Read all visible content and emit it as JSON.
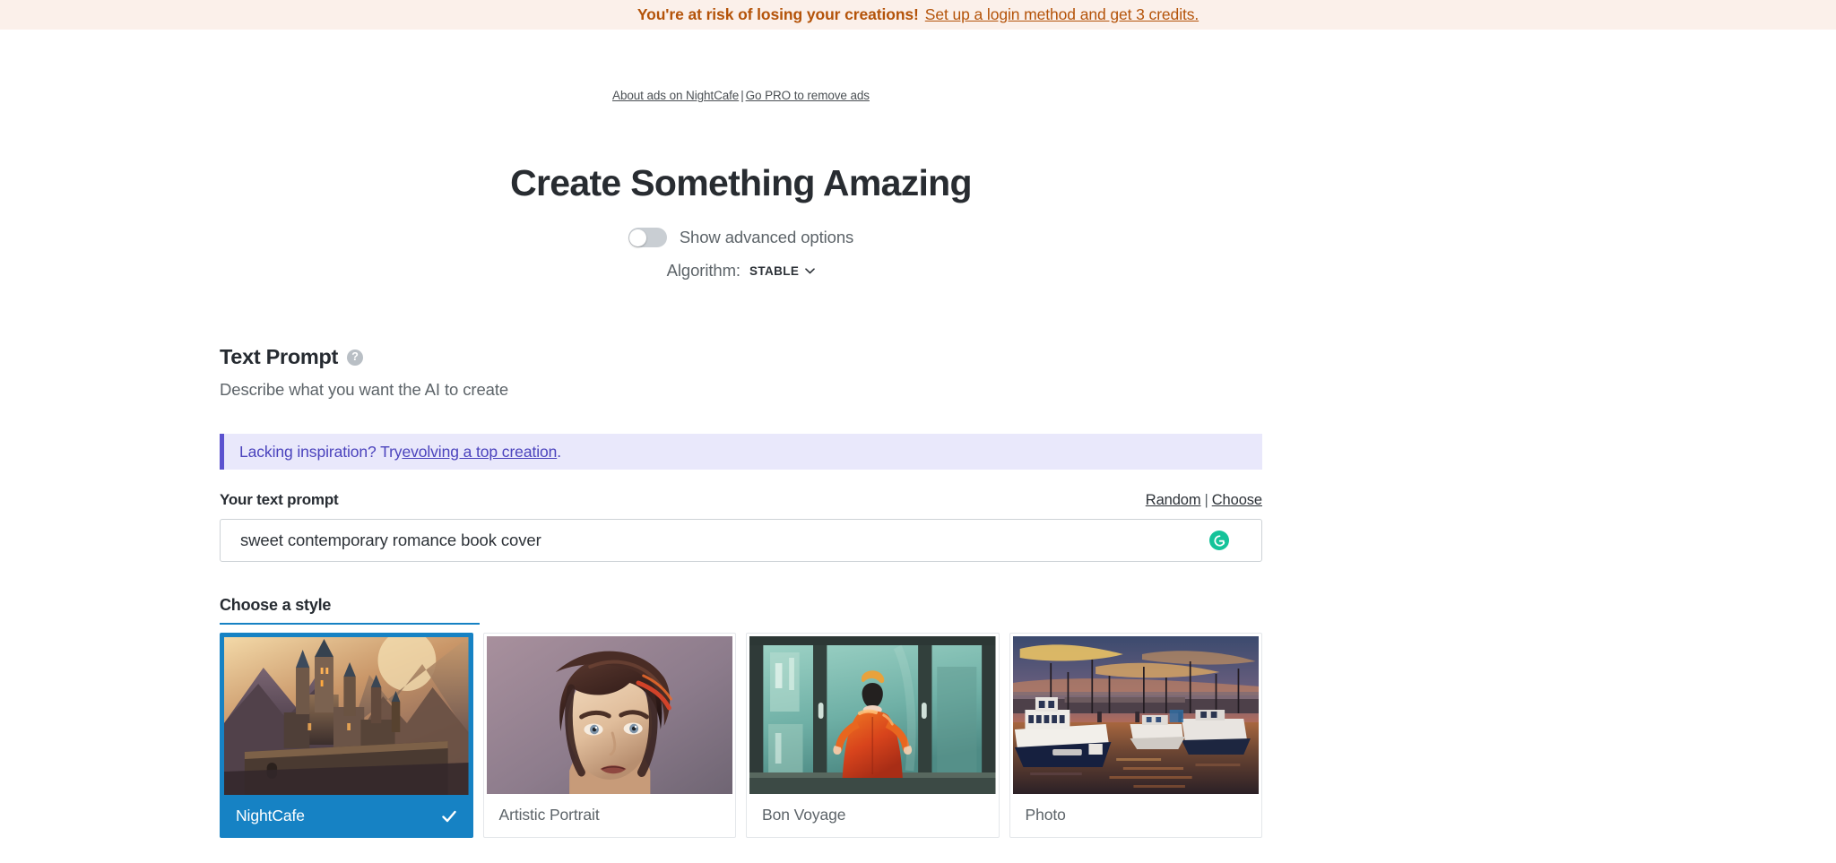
{
  "banner": {
    "warning": "You're at risk of losing your creations!",
    "link": "Set up a login method and get 3 credits."
  },
  "ads": {
    "about": "About ads on NightCafe",
    "separator": "|",
    "pro": "Go PRO to remove ads"
  },
  "hero": {
    "title": "Create Something Amazing",
    "advanced_toggle_label": "Show advanced options",
    "advanced_toggle_state": "off",
    "algorithm_label": "Algorithm:",
    "algorithm_value": "STABLE"
  },
  "prompt_section": {
    "title": "Text Prompt",
    "help_glyph": "?",
    "subtitle": "Describe what you want the AI to create",
    "callout_prefix": "Lacking inspiration? Try ",
    "callout_link": "evolving a top creation",
    "callout_suffix": ".",
    "field_label": "Your text prompt",
    "random_label": "Random",
    "actions_separator": "|",
    "choose_label": "Choose",
    "input_value": "sweet contemporary romance book cover",
    "input_placeholder": "Describe what you want the AI to create",
    "grammarly_icon": "grammarly-icon"
  },
  "style_section": {
    "title": "Choose a style",
    "accent_color": "#1682c4",
    "cards": [
      {
        "label": "NightCafe",
        "selected": true,
        "thumb": "fantasy-castle-mountains"
      },
      {
        "label": "Artistic Portrait",
        "selected": false,
        "thumb": "woman-portrait-painting"
      },
      {
        "label": "Bon Voyage",
        "selected": false,
        "thumb": "woman-red-dress-window"
      },
      {
        "label": "Photo",
        "selected": false,
        "thumb": "harbor-boats-sunset"
      }
    ]
  },
  "colors": {
    "banner_bg": "#fbf0ea",
    "banner_text": "#b45309",
    "callout_bg": "#e9e8fb",
    "callout_accent": "#5b52cf",
    "grammarly_green": "#15c39a"
  }
}
